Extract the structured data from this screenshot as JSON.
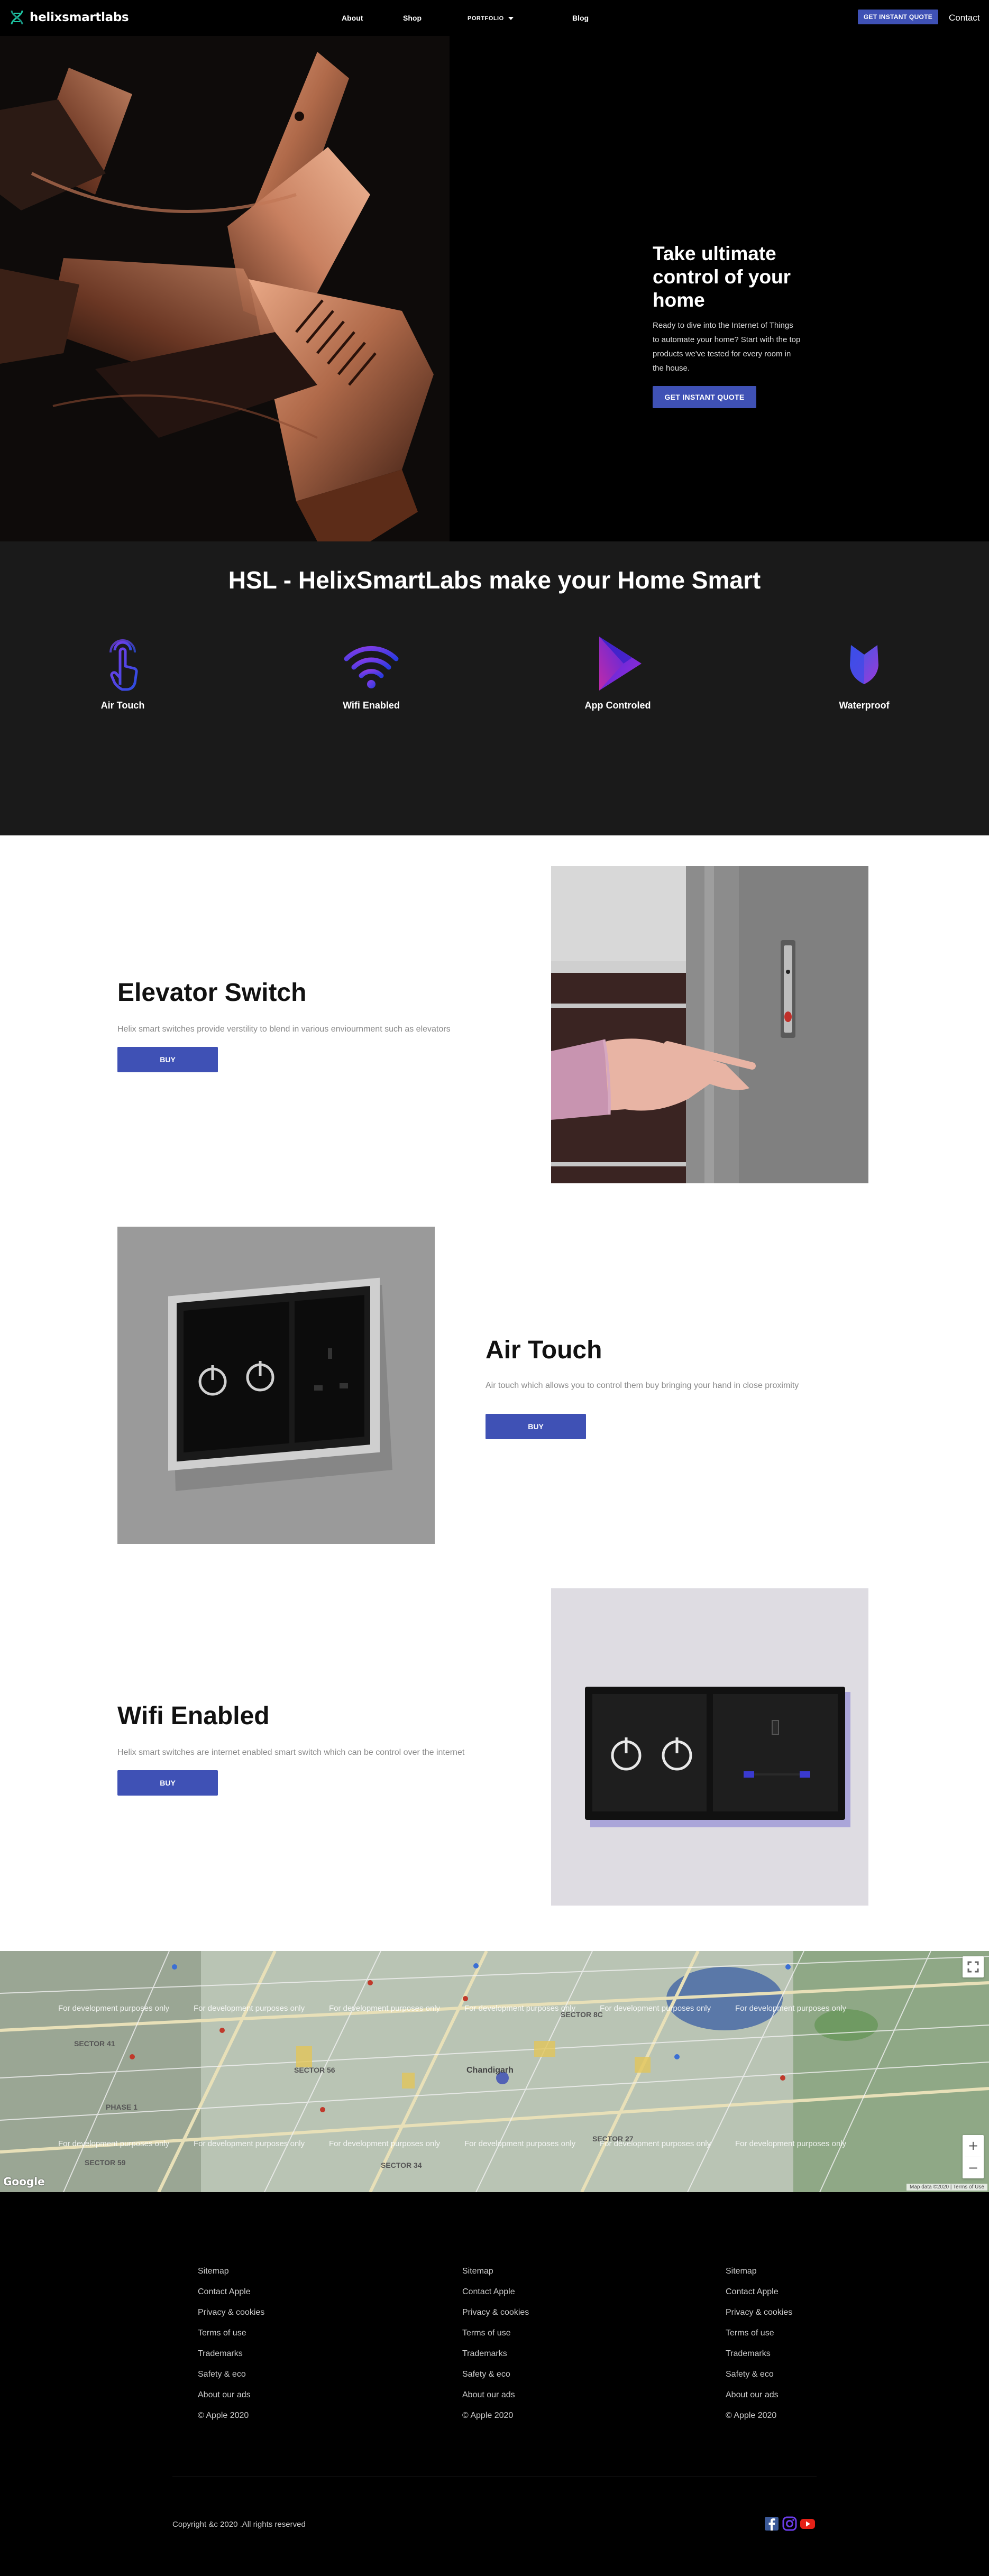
{
  "nav": {
    "brand": "helixsmartlabs",
    "links": [
      "About",
      "Shop",
      "PORTFOLIO",
      "Blog"
    ],
    "quote_button": "GET INSTANT QUOTE",
    "contact": "Contact"
  },
  "hero": {
    "title": "Take ultimate control of your home",
    "text": "Ready to dive into the Internet of Things to automate your home? Start with the top products we've tested for every room in the house.",
    "button": "GET INSTANT QUOTE"
  },
  "features": {
    "title": "HSL - HelixSmartLabs make your Home Smart",
    "items": [
      {
        "label": "Air Touch",
        "icon": "touch-hand-icon"
      },
      {
        "label": "Wifi Enabled",
        "icon": "wifi-icon"
      },
      {
        "label": "App Controled",
        "icon": "play-store-icon"
      },
      {
        "label": "Waterproof",
        "icon": "shield-icon"
      }
    ]
  },
  "products": [
    {
      "title": "Elevator Switch",
      "description": "Helix smart switches provide verstility to blend in various enviournment such as elevators",
      "button": "BUY"
    },
    {
      "title": "Air Touch",
      "description": "Air touch which allows you to control them buy bringing your hand in close proximity",
      "button": "BUY"
    },
    {
      "title": "Wifi Enabled",
      "description": "Helix smart switches are internet enabled smart switch which can be control over the internet",
      "button": "BUY"
    }
  ],
  "map": {
    "watermark": "For development purposes only",
    "labels": {
      "sector_41": "SECTOR 41",
      "sector_8c": "SECTOR 8C",
      "sector_27": "SECTOR 27",
      "phase_1": "PHASE 1",
      "sector_59": "SECTOR 59",
      "sector_34": "SECTOR 34",
      "chandigarh": "Chandigarh",
      "sector_56": "SECTOR 56"
    },
    "google": "Google",
    "terms": "Map data ©2020 | Terms of Use",
    "zoom_in": "+",
    "zoom_out": "−"
  },
  "footer": {
    "columns": [
      [
        "Sitemap",
        "Contact Apple",
        "Privacy & cookies",
        "Terms of use",
        "Trademarks",
        "Safety & eco",
        "About our ads",
        "© Apple 2020"
      ],
      [
        "Sitemap",
        "Contact Apple",
        "Privacy & cookies",
        "Terms of use",
        "Trademarks",
        "Safety & eco",
        "About our ads",
        "© Apple 2020"
      ],
      [
        "Sitemap",
        "Contact Apple",
        "Privacy & cookies",
        "Terms of use",
        "Trademarks",
        "Safety & eco",
        "About our ads",
        "© Apple 2020"
      ]
    ],
    "copyright": "Copyright &c 2020 .All rights reserved",
    "social_icons": [
      "facebook-icon",
      "instagram-icon",
      "youtube-icon"
    ]
  },
  "colors": {
    "accent": "#3f51b5",
    "hero_bg": "#000000",
    "features_bg": "#1a1a1a",
    "copper": "#b06a4a"
  }
}
